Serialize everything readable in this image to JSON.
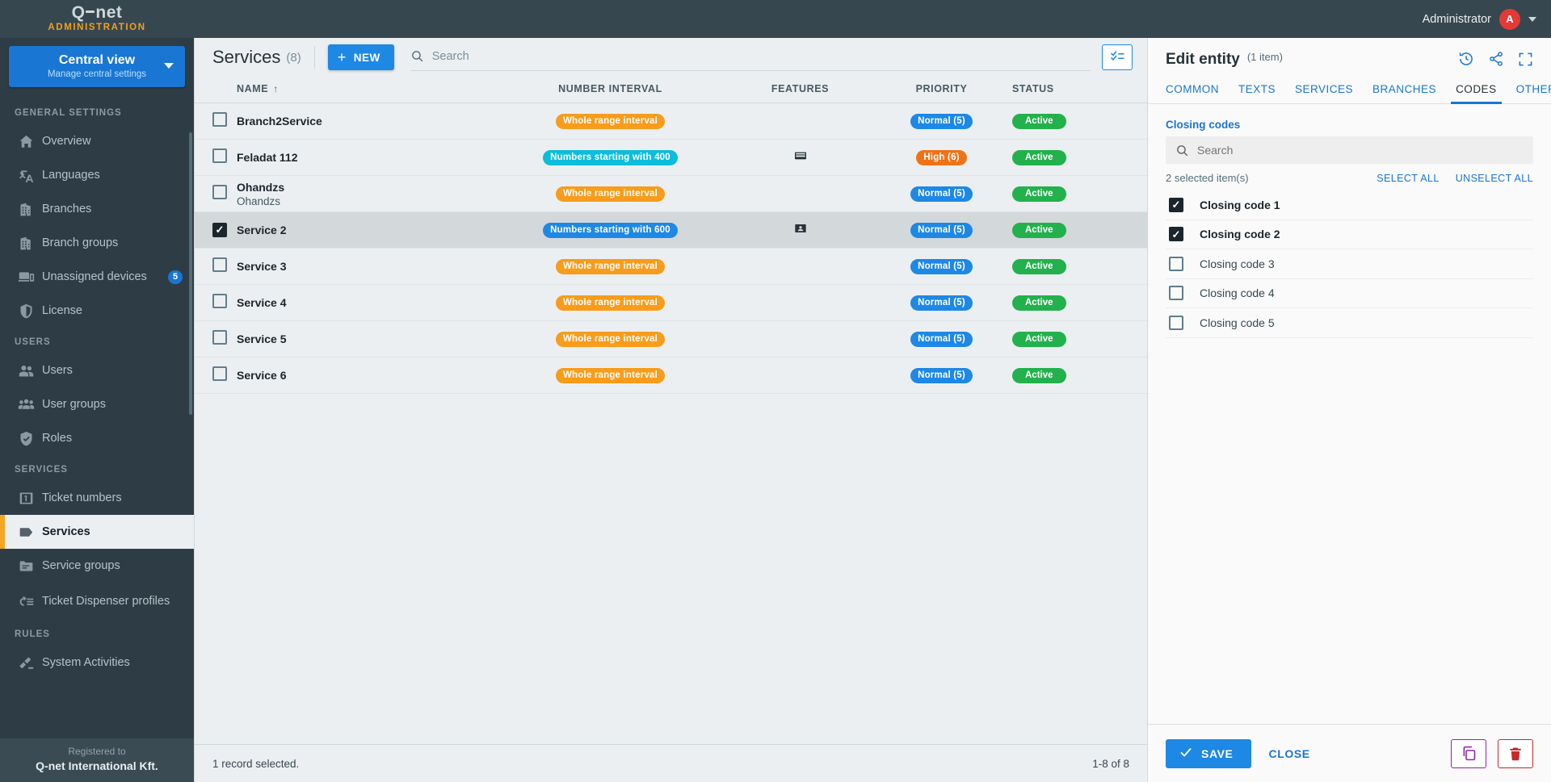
{
  "topbar": {
    "logo_left": "Q",
    "logo_right": "net",
    "logo_sub": "ADMINISTRATION",
    "admin_label": "Administrator",
    "avatar_initial": "A"
  },
  "sidebar": {
    "view_selector": {
      "title": "Central view",
      "subtitle": "Manage central settings"
    },
    "sections": [
      {
        "title": "GENERAL SETTINGS",
        "items": [
          {
            "label": "Overview",
            "icon": "home-icon",
            "active": false
          },
          {
            "label": "Languages",
            "icon": "translate-icon",
            "active": false
          },
          {
            "label": "Branches",
            "icon": "building-icon",
            "active": false
          },
          {
            "label": "Branch groups",
            "icon": "buildings-icon",
            "active": false
          },
          {
            "label": "Unassigned devices",
            "icon": "devices-icon",
            "active": false,
            "badge": "5"
          },
          {
            "label": "License",
            "icon": "shield-icon",
            "active": false
          }
        ]
      },
      {
        "title": "USERS",
        "items": [
          {
            "label": "Users",
            "icon": "users-icon",
            "active": false
          },
          {
            "label": "User groups",
            "icon": "user-group-icon",
            "active": false
          },
          {
            "label": "Roles",
            "icon": "shield-check-icon",
            "active": false
          }
        ]
      },
      {
        "title": "SERVICES",
        "items": [
          {
            "label": "Ticket numbers",
            "icon": "number-one-icon",
            "active": false
          },
          {
            "label": "Services",
            "icon": "tag-icon",
            "active": true
          },
          {
            "label": "Service groups",
            "icon": "folder-icon",
            "active": false
          },
          {
            "label": "Ticket Dispenser profiles",
            "icon": "dispenser-icon",
            "active": false,
            "two_line": true
          }
        ]
      },
      {
        "title": "RULES",
        "items": [
          {
            "label": "System Activities",
            "icon": "activities-icon",
            "active": false
          }
        ]
      }
    ],
    "footer": {
      "registered_to_label": "Registered to",
      "company": "Q-net International Kft."
    }
  },
  "main": {
    "title": "Services",
    "count": "(8)",
    "new_button": "NEW",
    "search_placeholder": "Search",
    "columns": [
      {
        "label": "NAME",
        "sort": "↑"
      },
      {
        "label": "NUMBER INTERVAL"
      },
      {
        "label": "FEATURES"
      },
      {
        "label": "PRIORITY"
      },
      {
        "label": "STATUS"
      }
    ],
    "rows": [
      {
        "checked": false,
        "selected": false,
        "name": "Branch2Service",
        "subtitle": "",
        "interval": "Whole range interval",
        "interval_color": "orange",
        "feature_icon": "",
        "priority": "Normal (5)",
        "priority_color": "blue",
        "status": "Active"
      },
      {
        "checked": false,
        "selected": false,
        "name": "Feladat 112",
        "subtitle": "",
        "interval": "Numbers starting with 400",
        "interval_color": "cyan",
        "feature_icon": "card-icon",
        "priority": "High (6)",
        "priority_color": "high",
        "status": "Active"
      },
      {
        "checked": false,
        "selected": false,
        "name": "Ohandzs",
        "subtitle": "Ohandzs",
        "interval": "Whole range interval",
        "interval_color": "orange",
        "feature_icon": "",
        "priority": "Normal (5)",
        "priority_color": "blue",
        "status": "Active"
      },
      {
        "checked": true,
        "selected": true,
        "name": "Service 2",
        "subtitle": "",
        "interval": "Numbers starting with 600",
        "interval_color": "blue",
        "feature_icon": "id-card-icon",
        "priority": "Normal (5)",
        "priority_color": "blue",
        "status": "Active"
      },
      {
        "checked": false,
        "selected": false,
        "name": "Service 3",
        "subtitle": "",
        "interval": "Whole range interval",
        "interval_color": "orange",
        "feature_icon": "",
        "priority": "Normal (5)",
        "priority_color": "blue",
        "status": "Active"
      },
      {
        "checked": false,
        "selected": false,
        "name": "Service 4",
        "subtitle": "",
        "interval": "Whole range interval",
        "interval_color": "orange",
        "feature_icon": "",
        "priority": "Normal (5)",
        "priority_color": "blue",
        "status": "Active"
      },
      {
        "checked": false,
        "selected": false,
        "name": "Service 5",
        "subtitle": "",
        "interval": "Whole range interval",
        "interval_color": "orange",
        "feature_icon": "",
        "priority": "Normal (5)",
        "priority_color": "blue",
        "status": "Active"
      },
      {
        "checked": false,
        "selected": false,
        "name": "Service 6",
        "subtitle": "",
        "interval": "Whole range interval",
        "interval_color": "orange",
        "feature_icon": "",
        "priority": "Normal (5)",
        "priority_color": "blue",
        "status": "Active"
      }
    ],
    "footer": {
      "selection_text": "1 record selected.",
      "pagination_text": "1-8 of 8"
    }
  },
  "panel": {
    "title": "Edit entity",
    "subtitle": "(1 item)",
    "header_icons": [
      "history-icon",
      "share-icon",
      "fullscreen-icon"
    ],
    "tabs": [
      {
        "label": "COMMON",
        "active": false
      },
      {
        "label": "TEXTS",
        "active": false
      },
      {
        "label": "SERVICES",
        "active": false
      },
      {
        "label": "BRANCHES",
        "active": false
      },
      {
        "label": "CODES",
        "active": true
      },
      {
        "label": "OTHERS",
        "active": false
      }
    ],
    "section_label": "Closing codes",
    "search_placeholder": "Search",
    "selected_text": "2 selected item(s)",
    "select_all": "SELECT ALL",
    "unselect_all": "UNSELECT ALL",
    "codes": [
      {
        "label": "Closing code 1",
        "checked": true
      },
      {
        "label": "Closing code 2",
        "checked": true
      },
      {
        "label": "Closing code 3",
        "checked": false
      },
      {
        "label": "Closing code 4",
        "checked": false
      },
      {
        "label": "Closing code 5",
        "checked": false
      }
    ],
    "save_label": "SAVE",
    "close_label": "CLOSE"
  },
  "colors": {
    "accent_blue": "#1e88e5",
    "sidebar_bg": "#2e3d45",
    "active_orange": "#f5a623",
    "status_green": "#22b14c",
    "pill_orange": "#f79c1b",
    "pill_cyan": "#0cbddd",
    "pill_high": "#ef7316",
    "delete_red": "#c62828",
    "copy_purple": "#8e24aa"
  }
}
